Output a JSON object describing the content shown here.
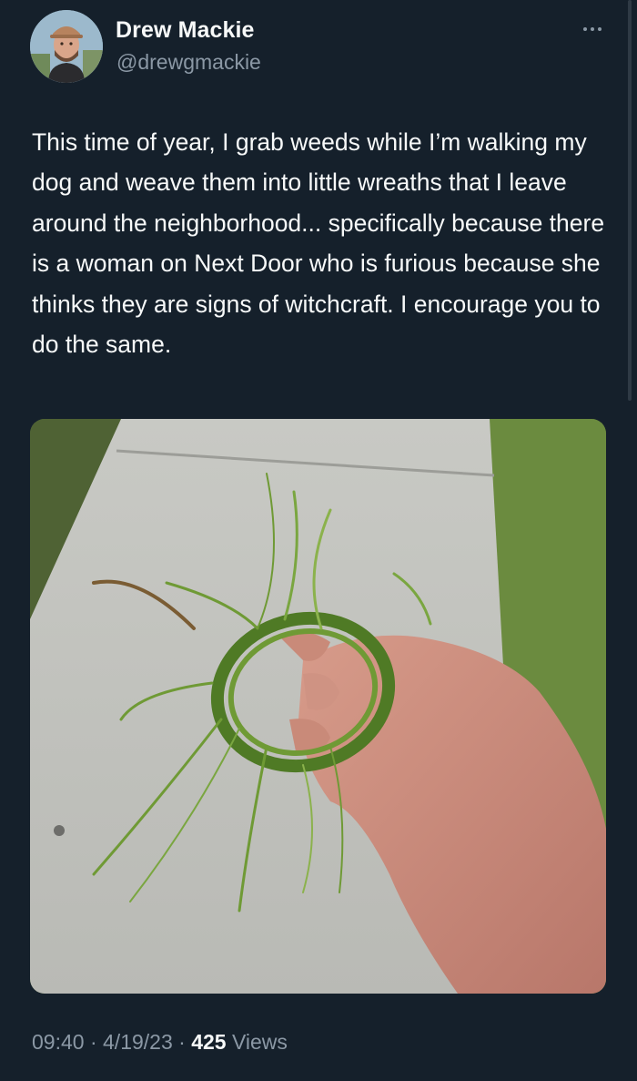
{
  "author": {
    "name": "Drew Mackie",
    "handle": "@drewgmackie"
  },
  "tweet": {
    "text": "This time of year, I grab weeds while I’m walking my dog and weave them into little wreaths that I leave around the neighborhood... specifically because there is a woman on Next Door who is furious because she thinks they are signs of witchcraft. I encourage you to do the same.",
    "time": "09:40",
    "separator": " · ",
    "date": "4/19/23",
    "views_count": "425",
    "views_label": " Views"
  },
  "icons": {
    "more": "more-horizontal-icon",
    "avatar": "avatar"
  },
  "colors": {
    "background": "#15202b",
    "primary_text": "#f7f9f9",
    "secondary_text": "#8b98a5"
  }
}
